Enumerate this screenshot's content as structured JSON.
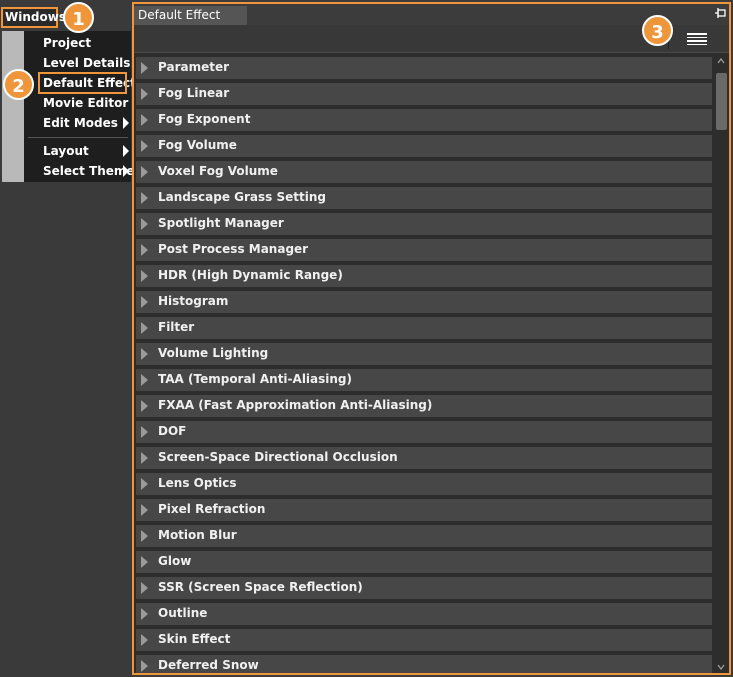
{
  "menu": {
    "windows_label": "Windows",
    "items": [
      {
        "label": "Project"
      },
      {
        "label": "Level Details"
      },
      {
        "label": "Default Effect"
      },
      {
        "label": "Movie Editor"
      },
      {
        "label": "Edit Modes"
      },
      {
        "label": "Layout"
      },
      {
        "label": "Select Theme"
      }
    ]
  },
  "badges": {
    "one": "1",
    "two": "2",
    "three": "3"
  },
  "panel": {
    "tab_title": "Default Effect",
    "sections": [
      "Parameter",
      "Fog Linear",
      "Fog Exponent",
      "Fog Volume",
      "Voxel Fog Volume",
      "Landscape Grass Setting",
      "Spotlight Manager",
      "Post Process Manager",
      "HDR (High Dynamic Range)",
      "Histogram",
      "Filter",
      "Volume Lighting",
      "TAA (Temporal Anti-Aliasing)",
      "FXAA (Fast Approximation Anti-Aliasing)",
      "DOF",
      "Screen-Space Directional Occlusion",
      "Lens Optics",
      "Pixel Refraction",
      "Motion Blur",
      "Glow",
      "SSR (Screen Space Reflection)",
      "Outline",
      "Skin Effect",
      "Deferred Snow"
    ]
  },
  "colors": {
    "highlight": "#f0963a",
    "row_bg": "#474747",
    "panel_bg": "#2d2d2d"
  }
}
